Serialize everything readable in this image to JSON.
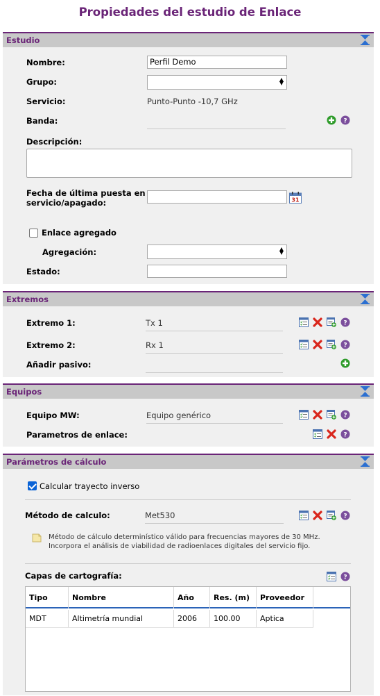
{
  "page_title": "Propiedades del estudio de Enlace",
  "estudio": {
    "header": "Estudio",
    "nombre_label": "Nombre:",
    "nombre_value": "Perfil Demo",
    "grupo_label": "Grupo:",
    "grupo_value": "",
    "servicio_label": "Servicio:",
    "servicio_value": "Punto-Punto -10,7 GHz",
    "banda_label": "Banda:",
    "banda_value": "",
    "descripcion_label": "Descripción:",
    "descripcion_value": "",
    "fecha_label_1": "Fecha de última puesta en",
    "fecha_label_2": "servicio/apagado:",
    "fecha_value": "",
    "enlace_agregado_label": "Enlace agregado",
    "enlace_agregado_checked": false,
    "agregacion_label": "Agregación:",
    "agregacion_value": "",
    "estado_label": "Estado:",
    "estado_value": ""
  },
  "extremos": {
    "header": "Extremos",
    "extremo1_label": "Extremo 1:",
    "extremo1_value": "Tx 1",
    "extremo2_label": "Extremo 2:",
    "extremo2_value": "Rx 1",
    "pasivo_label": "Añadir pasivo:",
    "pasivo_value": ""
  },
  "equipos": {
    "header": "Equipos",
    "equipo_label": "Equipo MW:",
    "equipo_value": "Equipo genérico",
    "parametros_label": "Parametros de enlace:"
  },
  "calculo": {
    "header": "Parámetros de cálculo",
    "inverso_label": "Calcular trayecto inverso",
    "inverso_checked": true,
    "metodo_label": "Método de calculo:",
    "metodo_value": "Met530",
    "metodo_desc_1": "Método de cálculo determinístico válido para frecuencias mayores de 30 MHz.",
    "metodo_desc_2": "Incorpora el análisis de viabilidad de radioenlaces digitales del servicio fijo.",
    "capas_label": "Capas de cartografía:",
    "table": {
      "columns": [
        "Tipo",
        "Nombre",
        "Año",
        "Res. (m)",
        "Proveedor"
      ],
      "rows": [
        [
          "MDT",
          "Altimetría mundial",
          "2006",
          "100.00",
          "Aptica"
        ]
      ]
    }
  },
  "colors": {
    "accent": "#6a2477",
    "header_bg": "#c8c8c8",
    "section_bg": "#f0f0f0",
    "delete_red": "#d9261c",
    "add_green": "#2e9b2a",
    "help_purple": "#7b4e9c",
    "checkbox_blue": "#0a63d6"
  },
  "icons": {
    "collapse": "collapse-arrows-icon",
    "add": "add-circle-icon",
    "help": "help-icon",
    "edit": "edit-list-icon",
    "delete": "delete-x-icon",
    "new": "new-item-icon",
    "calendar": "calendar-icon",
    "info": "note-icon"
  }
}
